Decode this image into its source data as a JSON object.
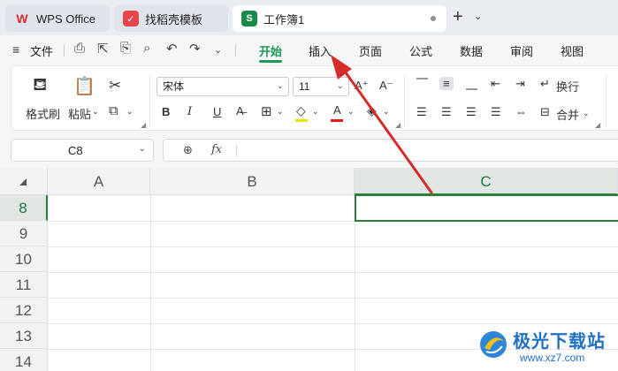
{
  "tabs": [
    {
      "label": "WPS Office",
      "icon": "wps-logo-icon"
    },
    {
      "label": "找稻壳模板",
      "icon": "template-icon"
    },
    {
      "label": "工作簿1",
      "icon": "spreadsheet-icon",
      "icon_letter": "S",
      "active": true
    }
  ],
  "menu": {
    "file_label": "文件",
    "tabs": [
      "开始",
      "插入",
      "页面",
      "公式",
      "数据",
      "审阅",
      "视图"
    ],
    "active_tab": "开始"
  },
  "ribbon": {
    "format_painter": "格式刷",
    "paste": "粘贴",
    "font_name": "宋体",
    "font_size": "11",
    "wrap_text": "换行",
    "merge": "合并",
    "bold": "B",
    "italic": "I",
    "underline": "U",
    "font_color_letter": "A",
    "grow_font": "A⁺",
    "shrink_font": "A⁻"
  },
  "formula_bar": {
    "cell_ref": "C8",
    "fx_label": "fx",
    "value": ""
  },
  "grid": {
    "columns": [
      "A",
      "B",
      "C"
    ],
    "rows": [
      "8",
      "9",
      "10",
      "11",
      "12",
      "13",
      "14"
    ],
    "selected_cell": "C8"
  },
  "watermark": {
    "title": "极光下载站",
    "url": "www.xz7.com"
  },
  "colors": {
    "accent_green": "#1d9a55",
    "selection_green": "#2d7d3a",
    "annotation_arrow": "#d62b2b",
    "watermark_blue": "#1f6fc2"
  }
}
